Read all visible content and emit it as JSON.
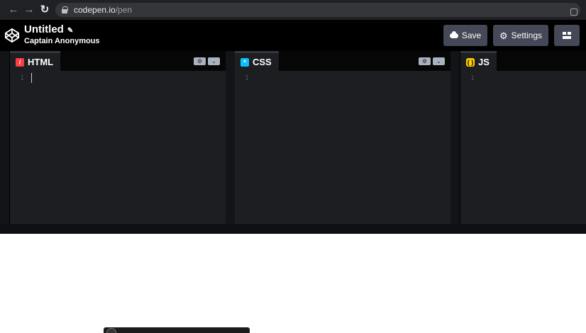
{
  "browser": {
    "url_domain": "codepen.io",
    "url_path": "/pen"
  },
  "header": {
    "title": "Untitled",
    "author": "Captain Anonymous",
    "save_label": "Save",
    "settings_label": "Settings"
  },
  "panels": [
    {
      "label": "HTML",
      "icon": "html-icon",
      "line": "1"
    },
    {
      "label": "CSS",
      "icon": "css-icon",
      "line": "1"
    },
    {
      "label": "JS",
      "icon": "js-icon",
      "line": "1"
    }
  ],
  "colors": {
    "html_accent": "#ff3c41",
    "css_accent": "#0ebeff",
    "js_accent": "#fcd000",
    "header_bg": "#000000",
    "button_bg": "#444857",
    "editor_bg": "#1d1e22"
  }
}
